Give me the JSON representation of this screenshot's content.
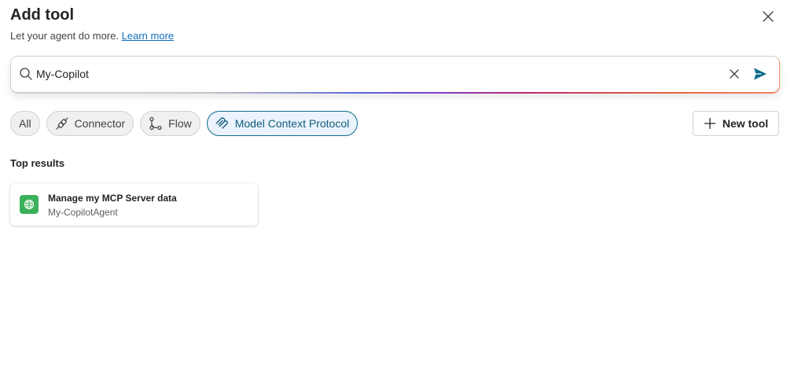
{
  "header": {
    "title": "Add tool",
    "subtitle": "Let your agent do more.",
    "learn_more": "Learn more"
  },
  "icons": {
    "close": "close-icon",
    "search": "search-icon",
    "clear": "clear-icon",
    "send": "send-icon",
    "connector": "connector-icon",
    "flow": "flow-icon",
    "mcp": "mcp-icon",
    "add": "add-icon",
    "globe": "globe-icon"
  },
  "search": {
    "value": "My-Copilot"
  },
  "filters": [
    {
      "label": "All",
      "active": false
    },
    {
      "label": "Connector",
      "active": false
    },
    {
      "label": "Flow",
      "active": false
    },
    {
      "label": "Model Context Protocol",
      "active": true
    }
  ],
  "new_tool_label": "New tool",
  "results": {
    "title": "Top results",
    "items": [
      {
        "title": "Manage my MCP Server data",
        "subtitle": "My-CopilotAgent"
      }
    ]
  },
  "colors": {
    "accent": "#0f6c8d",
    "link": "#0f6cbd",
    "card_icon_bg": "#3bb15b"
  }
}
